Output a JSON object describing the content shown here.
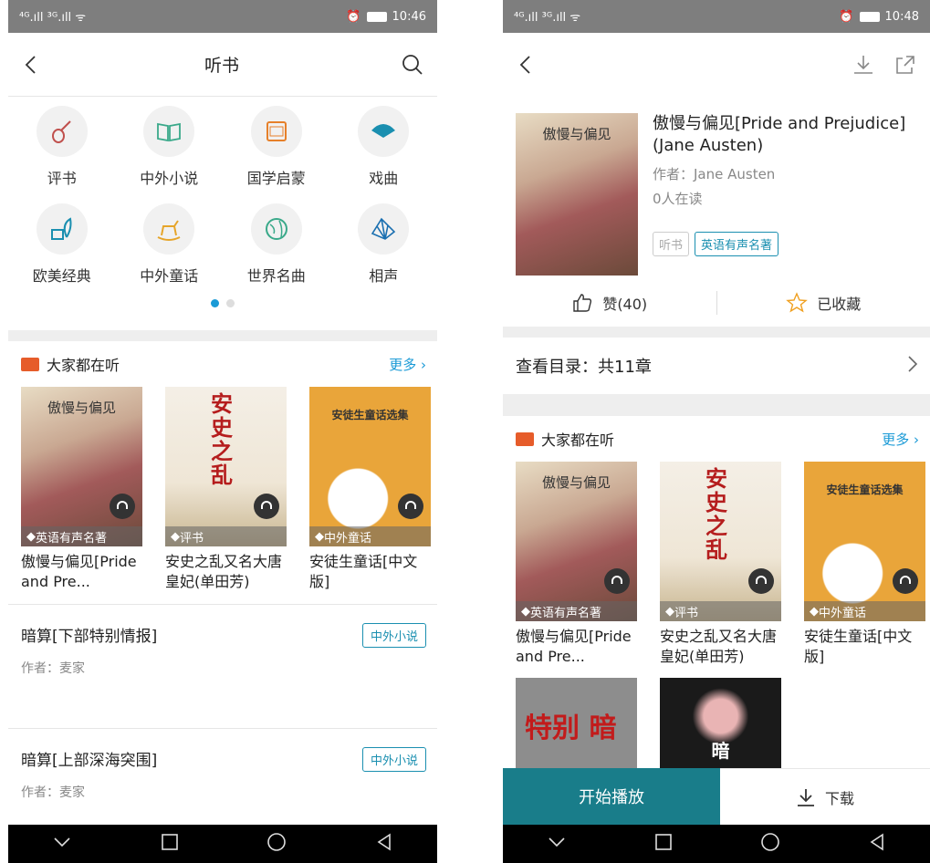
{
  "left": {
    "status": {
      "signal": "⁴ᴳ.ıll ³ᴳ.ıll ᯤ",
      "time": "10:46"
    },
    "title": "听书",
    "categories": [
      {
        "label": "评书",
        "icon": "pipa-icon",
        "color": "#c0504d"
      },
      {
        "label": "中外小说",
        "icon": "open-book-icon",
        "color": "#3aa98a"
      },
      {
        "label": "国学启蒙",
        "icon": "scroll-icon",
        "color": "#e6802a"
      },
      {
        "label": "戏曲",
        "icon": "fan-icon",
        "color": "#1a8fb0"
      },
      {
        "label": "欧美经典",
        "icon": "ink-quill-icon",
        "color": "#1a8fb0"
      },
      {
        "label": "中外童话",
        "icon": "rocking-horse-icon",
        "color": "#e6a52a"
      },
      {
        "label": "世界名曲",
        "icon": "globe-icon",
        "color": "#3aa98a"
      },
      {
        "label": "相声",
        "icon": "folding-fan-icon",
        "color": "#1a6fb0"
      }
    ],
    "section_title": "大家都在听",
    "more": "更多",
    "books": [
      {
        "title": "傲慢与偏见[Pride and Pre...",
        "tag": "英语有声名著",
        "cover_text": "傲慢与偏见"
      },
      {
        "title": "安史之乱又名大唐皇妃(单田芳)",
        "tag": "评书",
        "cover_text": "安史之乱"
      },
      {
        "title": "安徒生童话[中文版]",
        "tag": "中外童话",
        "cover_text": "安徒生童话选集"
      }
    ],
    "list": [
      {
        "title": "暗算[下部特别情报]",
        "author": "作者：麦家",
        "badge": "中外小说"
      },
      {
        "title": "暗算[上部深海突围]",
        "author": "作者：麦家",
        "badge": "中外小说"
      }
    ]
  },
  "right": {
    "status": {
      "signal": "⁴ᴳ.ıll ³ᴳ.ıll ᯤ",
      "time": "10:48"
    },
    "book": {
      "title": "傲慢与偏见[Pride and Prejudice](Jane Austen)",
      "author": "作者：Jane Austen",
      "readers": "0人在读",
      "tags": [
        "听书",
        "英语有声名著"
      ],
      "cover_text": "傲慢与偏见"
    },
    "like": "赞(40)",
    "fav": "已收藏",
    "catalog": "查看目录：共11章",
    "section_title": "大家都在听",
    "more": "更多",
    "books": [
      {
        "title": "傲慢与偏见[Pride and Pre...",
        "tag": "英语有声名著",
        "cover_text": "傲慢与偏见"
      },
      {
        "title": "安史之乱又名大唐皇妃(单田芳)",
        "tag": "评书",
        "cover_text": "安史之乱"
      },
      {
        "title": "安徒生童话[中文版]",
        "tag": "中外童话",
        "cover_text": "安徒生童话选集"
      }
    ],
    "books2": [
      {
        "cover_text": "特别 暗"
      },
      {
        "cover_text": "暗"
      }
    ],
    "play": "开始播放",
    "download": "下载"
  }
}
